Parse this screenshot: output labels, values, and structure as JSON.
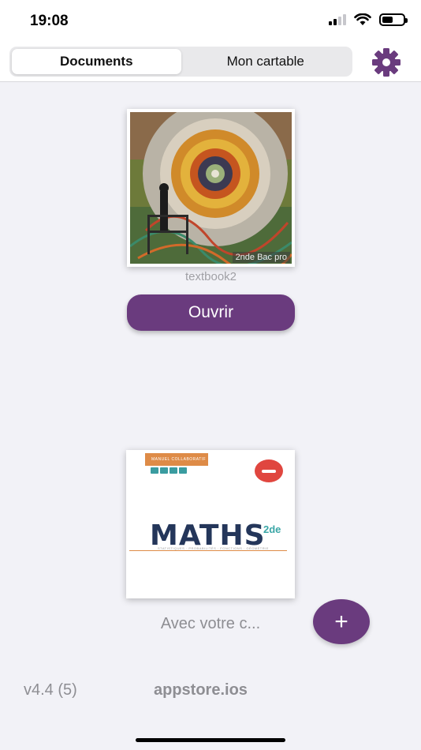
{
  "status_bar": {
    "time": "19:08"
  },
  "tabs": [
    {
      "label": "Documents",
      "active": true
    },
    {
      "label": "Mon cartable",
      "active": false
    }
  ],
  "icons": {
    "settings": "gear-icon",
    "remove": "minus-circle-icon",
    "add": "plus-icon"
  },
  "colors": {
    "accent": "#6a3b7e",
    "remove": "#e0463f",
    "background": "#f2f2f7"
  },
  "documents": [
    {
      "cover_tag": "2nde Bac pro",
      "name": "textbook2",
      "open_label": "Ouvrir"
    },
    {
      "cover_badge": "MANUEL COLLABORATIF",
      "cover_title": "MATHS",
      "cover_title_sup": "2de",
      "cover_subtitle": "STATISTIQUES · PROBABILITÉS · FONCTIONS · GÉOMÉTRIE"
    }
  ],
  "footer": {
    "with_text": "Avec votre c...",
    "add_label": "+",
    "version": "v4.4 (5)",
    "store": "appstore.ios"
  }
}
